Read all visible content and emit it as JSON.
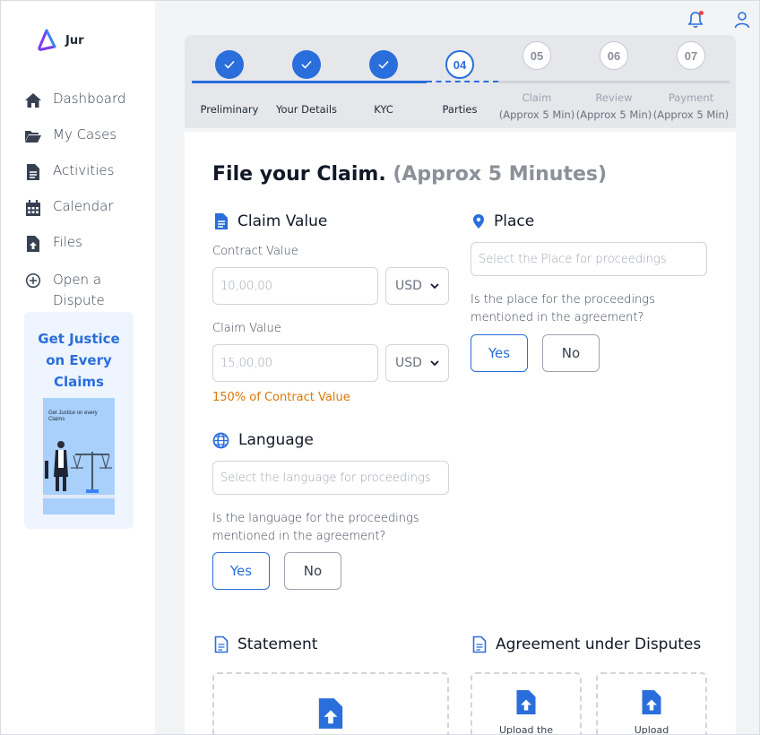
{
  "app": {
    "logo_text": "Jur"
  },
  "sidebar": {
    "items": [
      {
        "label": "Dashboard",
        "icon": "home-icon"
      },
      {
        "label": "My Cases",
        "icon": "folder-open-icon"
      },
      {
        "label": "Activities",
        "icon": "document-icon"
      },
      {
        "label": "Calendar",
        "icon": "calendar-icon"
      },
      {
        "label": "Files",
        "icon": "file-upload-icon"
      },
      {
        "label_line1": "Open a",
        "label_line2": "Dispute",
        "icon": "plus-circle-icon"
      }
    ],
    "promo": {
      "title_line1": "Get Justice",
      "title_line2": "on Every",
      "title_line3": "Claims",
      "image_caption": "Get Justice on every Claims"
    }
  },
  "topbar": {
    "notification_icon": "bell-icon",
    "has_unread": true,
    "profile_icon": "user-icon"
  },
  "stepper": {
    "steps": [
      {
        "number": "",
        "label": "Preliminary",
        "state": "done"
      },
      {
        "number": "",
        "label": "Your Details",
        "state": "done"
      },
      {
        "number": "",
        "label": "KYC",
        "state": "done"
      },
      {
        "number": "04",
        "label": "Parties",
        "state": "active"
      },
      {
        "number": "05",
        "label": "Claim",
        "sublabel": "(Approx 5 Min)",
        "state": "todo"
      },
      {
        "number": "06",
        "label": "Review",
        "sublabel": "(Approx 5 Min)",
        "state": "todo"
      },
      {
        "number": "07",
        "label": "Payment",
        "sublabel": "(Approx 5 Min)",
        "state": "todo"
      }
    ]
  },
  "form": {
    "title": "File your Claim.",
    "title_sub": "(Approx 5 Minutes)",
    "claim_value": {
      "heading": "Claim Value",
      "contract_label": "Contract Value",
      "contract_placeholder": "10,00,00",
      "contract_currency": "USD",
      "claim_label": "Claim  Value",
      "claim_placeholder": "15,00,00",
      "claim_currency": "USD",
      "hint": "150% of Contract Value"
    },
    "place": {
      "heading": "Place",
      "placeholder": "Select the Place for proceedings",
      "question_line1": "Is the place for the proceedings",
      "question_line2": "mentioned in the agreement?",
      "yes": "Yes",
      "no": "No"
    },
    "language": {
      "heading": "Language",
      "placeholder": "Select the language for proceedings",
      "question_line1": "Is the language for the proceedings",
      "question_line2": "mentioned in the agreement?",
      "yes": "Yes",
      "no": "No"
    },
    "statement": {
      "heading": "Statement"
    },
    "agreement": {
      "heading": "Agreement under Disputes",
      "upload1_text": "Upload the",
      "upload2_text": "Upload"
    }
  },
  "colors": {
    "accent": "#2a6edb",
    "hint": "#d97706",
    "background": "#f3f4f6"
  }
}
